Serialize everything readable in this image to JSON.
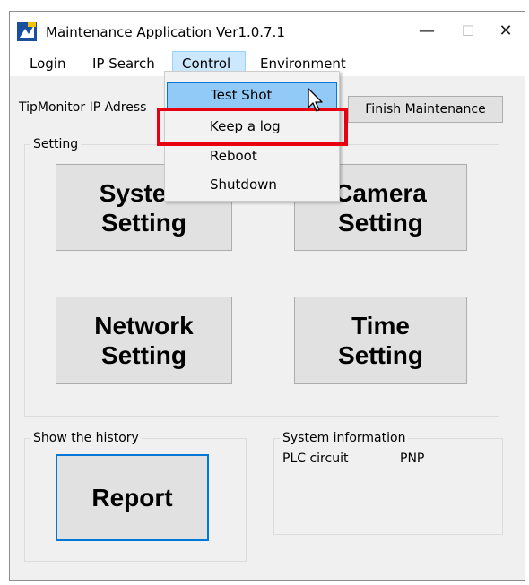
{
  "window": {
    "title": "Maintenance Application Ver1.0.7.1"
  },
  "controls": {
    "minimize": "—",
    "maximize": "☐",
    "close": "✕"
  },
  "menu": [
    "Login",
    "IP Search",
    "Control",
    "Environment"
  ],
  "dropdown": [
    "Test Shot",
    "Keep a log",
    "Reboot",
    "Shutdown"
  ],
  "top": {
    "ip_label": "TipMonitor IP Adress",
    "finish_button": "Finish Maintenance"
  },
  "setting_group": {
    "title": "Setting",
    "buttons": [
      "System\nSetting",
      "Camera\nSetting",
      "Network\nSetting",
      "Time\nSetting"
    ]
  },
  "history_group": {
    "title": "Show the history",
    "report_button": "Report"
  },
  "info_group": {
    "title": "System information",
    "plc_label": "PLC circuit",
    "plc_value": "PNP"
  },
  "colors": {
    "highlight": "#e60012",
    "menu_hover": "#91c9f7",
    "focus_border": "#0078d7"
  }
}
